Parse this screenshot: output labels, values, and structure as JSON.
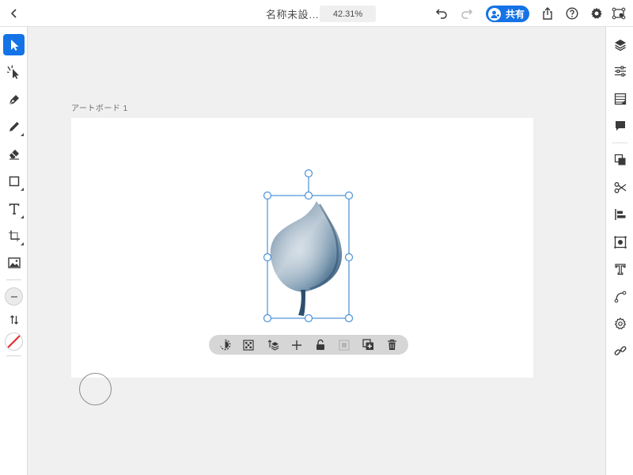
{
  "document": {
    "title": "名称未設…",
    "zoom": "42.31%"
  },
  "toolbar": {
    "share_label": "共有"
  },
  "artboard": {
    "label": "アートボード 1"
  },
  "colors": {
    "accent": "#1473e6",
    "leaf_dark": "#2d4e6f",
    "leaf_mid": "#5f7f9c",
    "leaf_light": "#b8c7d3",
    "no_fill_slash": "#e0332f"
  },
  "left_tools": [
    "select-tool",
    "direct-select-tool",
    "pen-tool",
    "pencil-tool",
    "eraser-tool",
    "rectangle-tool",
    "text-tool",
    "transform-tool",
    "image-tool",
    "stroke-swatch",
    "swap-colors",
    "fill-swatch"
  ],
  "right_tools": [
    "layers",
    "properties",
    "libraries",
    "comments",
    "shape-builder",
    "scissors",
    "align",
    "repeat-grid",
    "type-properties",
    "path",
    "settings",
    "link"
  ],
  "context_actions": [
    "rotate",
    "transparency-grid",
    "arrange",
    "move",
    "unlock",
    "disabled-action",
    "duplicate",
    "delete"
  ]
}
